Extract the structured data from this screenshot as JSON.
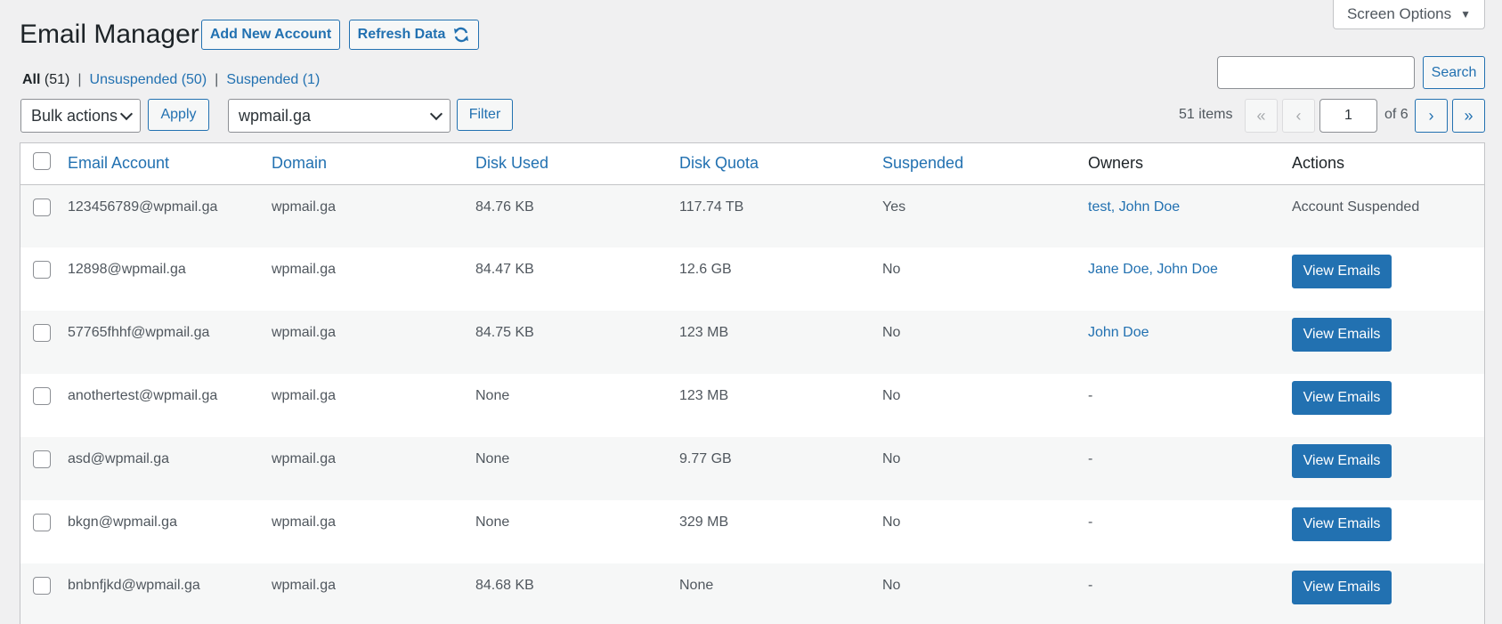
{
  "screen_options": {
    "label": "Screen Options"
  },
  "header": {
    "title": "Email Manager",
    "add_label": "Add New Account",
    "refresh_label": "Refresh Data"
  },
  "filters": {
    "all_label": "All",
    "all_count": "(51)",
    "unsuspended_label": "Unsuspended (50)",
    "suspended_label": "Suspended (1)",
    "sep": "|"
  },
  "search": {
    "button_label": "Search",
    "value": ""
  },
  "bulk": {
    "selected": "Bulk actions",
    "apply_label": "Apply"
  },
  "domain_filter": {
    "selected": "wpmail.ga",
    "filter_label": "Filter"
  },
  "pagination": {
    "items": "51 items",
    "first": "«",
    "prev": "‹",
    "current": "1",
    "of": "of 6",
    "next": "›",
    "last": "»"
  },
  "table": {
    "columns": {
      "email": "Email Account",
      "domain": "Domain",
      "disk_used": "Disk Used",
      "disk_quota": "Disk Quota",
      "suspended": "Suspended",
      "owners": "Owners",
      "actions": "Actions"
    },
    "rows": [
      {
        "email": "123456789@wpmail.ga",
        "domain": "wpmail.ga",
        "disk_used": "84.76 KB",
        "disk_quota": "117.74 TB",
        "suspended": "Yes",
        "owners": "test, John Doe",
        "owners_link": true,
        "action": "Account Suspended",
        "action_button": false
      },
      {
        "email": "12898@wpmail.ga",
        "domain": "wpmail.ga",
        "disk_used": "84.47 KB",
        "disk_quota": "12.6 GB",
        "suspended": "No",
        "owners": "Jane Doe, John Doe",
        "owners_link": true,
        "action": "View Emails",
        "action_button": true
      },
      {
        "email": "57765fhhf@wpmail.ga",
        "domain": "wpmail.ga",
        "disk_used": "84.75 KB",
        "disk_quota": "123 MB",
        "suspended": "No",
        "owners": "John Doe",
        "owners_link": true,
        "action": "View Emails",
        "action_button": true
      },
      {
        "email": "anothertest@wpmail.ga",
        "domain": "wpmail.ga",
        "disk_used": "None",
        "disk_quota": "123 MB",
        "suspended": "No",
        "owners": "-",
        "owners_link": false,
        "action": "View Emails",
        "action_button": true
      },
      {
        "email": "asd@wpmail.ga",
        "domain": "wpmail.ga",
        "disk_used": "None",
        "disk_quota": "9.77 GB",
        "suspended": "No",
        "owners": "-",
        "owners_link": false,
        "action": "View Emails",
        "action_button": true
      },
      {
        "email": "bkgn@wpmail.ga",
        "domain": "wpmail.ga",
        "disk_used": "None",
        "disk_quota": "329 MB",
        "suspended": "No",
        "owners": "-",
        "owners_link": false,
        "action": "View Emails",
        "action_button": true
      },
      {
        "email": "bnbnfjkd@wpmail.ga",
        "domain": "wpmail.ga",
        "disk_used": "84.68 KB",
        "disk_quota": "None",
        "suspended": "No",
        "owners": "-",
        "owners_link": false,
        "action": "View Emails",
        "action_button": true
      }
    ]
  }
}
